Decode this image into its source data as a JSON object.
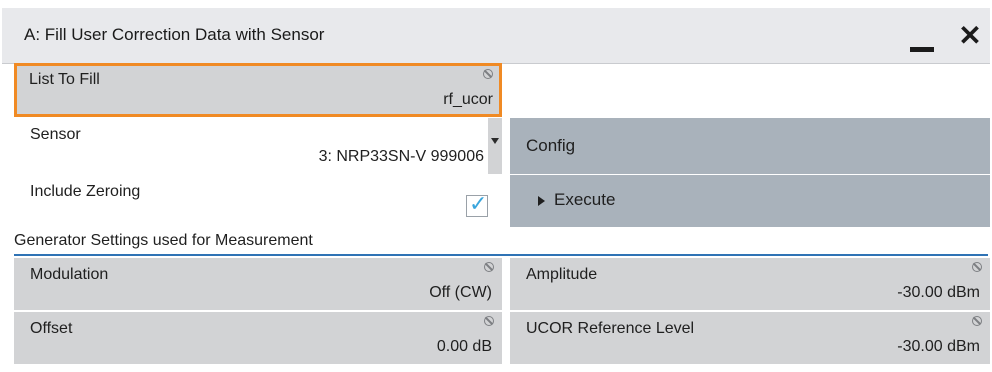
{
  "dialog": {
    "title": "A: Fill User Correction Data with Sensor"
  },
  "list_to_fill": {
    "label": "List To Fill",
    "value": "rf_ucor"
  },
  "sensor": {
    "label": "Sensor",
    "value": "3: NRP33SN-V 999006"
  },
  "include_zeroing": {
    "label": "Include Zeroing",
    "checked": true,
    "check_glyph": "✓"
  },
  "config_button": {
    "label": "Config"
  },
  "execute_button": {
    "label": "Execute"
  },
  "generator_section": {
    "title": "Generator Settings used for Measurement"
  },
  "modulation": {
    "label": "Modulation",
    "value": "Off (CW)"
  },
  "amplitude": {
    "label": "Amplitude",
    "value": "-30.00 dBm"
  },
  "offset": {
    "label": "Offset",
    "value": "0.00 dB"
  },
  "ucor_ref_level": {
    "label": "UCOR Reference Level",
    "value": "-30.00 dBm"
  },
  "icons": {
    "minimize": "minimize-icon",
    "close": "close-icon",
    "lock": "lock-icon",
    "dropdown": "chevron-down-icon",
    "play": "play-icon"
  },
  "colors": {
    "focus_border": "#f08a24",
    "section_line": "#2f73b5",
    "action_button": "#a9b2bb",
    "field_gray": "#d2d3d5",
    "checkbox_tick": "#3aa6dd"
  }
}
